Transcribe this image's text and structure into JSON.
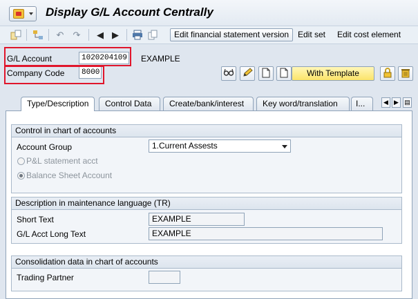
{
  "title": "Display G/L Account Centrally",
  "toolbar": {
    "buttons": [
      "Edit financial statement version"
    ],
    "links": [
      "Edit set",
      "Edit cost element"
    ]
  },
  "header": {
    "gl_account_label": "G/L Account",
    "gl_account_value": "1020204109",
    "gl_account_desc": "EXAMPLE",
    "company_code_label": "Company Code",
    "company_code_value": "8000",
    "template_button": "With Template"
  },
  "tabs": [
    "Type/Description",
    "Control Data",
    "Create/bank/interest",
    "Key word/translation",
    "I..."
  ],
  "control_group": {
    "title": "Control in chart of accounts",
    "account_group_label": "Account Group",
    "account_group_value": "1.Current Assests",
    "radio_pl": "P&L statement acct",
    "radio_bs": "Balance Sheet Account"
  },
  "description_group": {
    "title": "Description in maintenance language (TR)",
    "short_text_label": "Short Text",
    "short_text_value": "EXAMPLE",
    "long_text_label": "G/L Acct Long Text",
    "long_text_value": "EXAMPLE"
  },
  "consolidation_group": {
    "title": "Consolidation data in chart of accounts",
    "trading_partner_label": "Trading Partner",
    "trading_partner_value": ""
  },
  "colors": {
    "highlight": "#e0152b",
    "template_button": "#fbe46a",
    "background": "#dfe6ef"
  },
  "icons": [
    "menu-icon",
    "other-object-icon",
    "hierarchy-icon",
    "undo-icon",
    "redo-icon",
    "previous-icon",
    "next-icon",
    "print-icon",
    "copy-icon",
    "glasses-icon",
    "pencil-icon",
    "new-document-icon",
    "create-document-icon",
    "lock-icon",
    "trash-icon"
  ]
}
